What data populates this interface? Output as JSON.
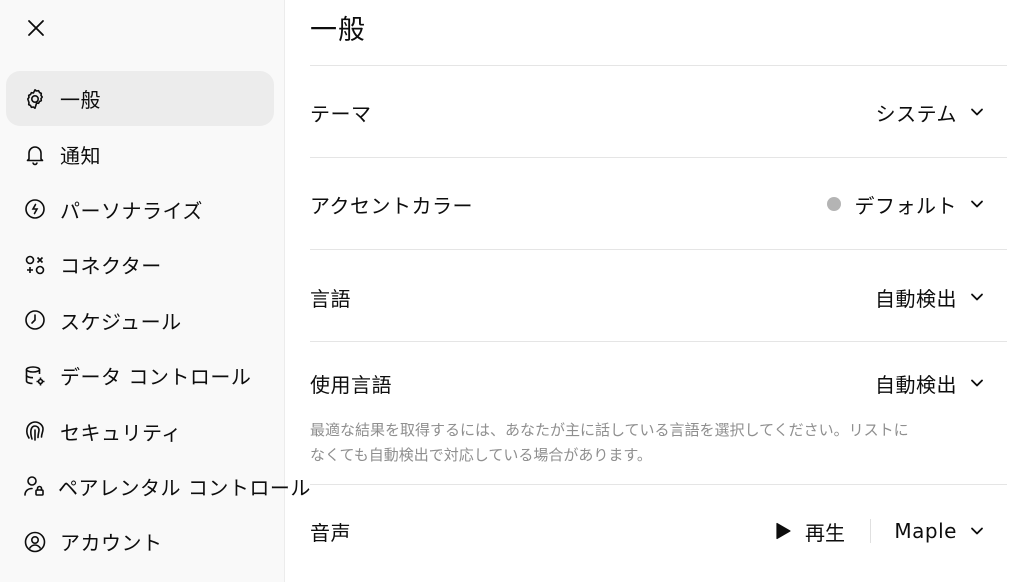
{
  "sidebar": {
    "close_icon": "close-icon",
    "items": [
      {
        "label": "一般",
        "icon": "gear-icon",
        "active": true
      },
      {
        "label": "通知",
        "icon": "bell-icon"
      },
      {
        "label": "パーソナライズ",
        "icon": "personalize-icon"
      },
      {
        "label": "コネクター",
        "icon": "connectors-icon"
      },
      {
        "label": "スケジュール",
        "icon": "clock-icon"
      },
      {
        "label": "データ コントロール",
        "icon": "database-gear-icon"
      },
      {
        "label": "セキュリティ",
        "icon": "fingerprint-icon"
      },
      {
        "label": "ペアレンタル コントロール",
        "icon": "user-lock-icon"
      },
      {
        "label": "アカウント",
        "icon": "user-circle-icon"
      }
    ]
  },
  "main": {
    "title": "一般",
    "settings": {
      "theme": {
        "label": "テーマ",
        "value": "システム"
      },
      "accent": {
        "label": "アクセントカラー",
        "value": "デフォルト",
        "color": "#b4b4b4"
      },
      "language": {
        "label": "言語",
        "value": "自動検出"
      },
      "spoken_language": {
        "label": "使用言語",
        "value": "自動検出",
        "help_line1": "最適な結果を取得するには、あなたが主に話している言語を選択してください。リストに",
        "help_line2": "なくても自動検出で対応している場合があります。"
      },
      "voice": {
        "label": "音声",
        "play_label": "再生",
        "value": "Maple"
      }
    }
  }
}
